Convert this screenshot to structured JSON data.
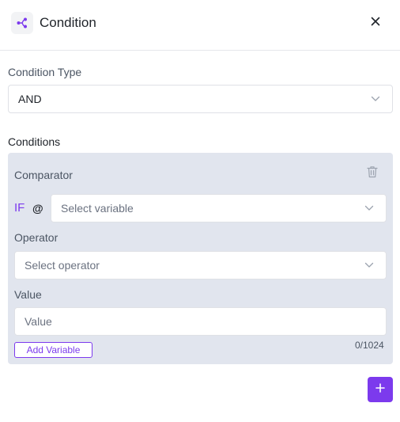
{
  "header": {
    "title": "Condition",
    "icon": "branch-icon",
    "close_icon": "close-icon"
  },
  "condition_type": {
    "label": "Condition Type",
    "value": "AND"
  },
  "conditions": {
    "label": "Conditions",
    "comparator": {
      "title": "Comparator",
      "delete_icon": "trash-icon",
      "if_label": "IF",
      "at_label": "@",
      "variable_placeholder": "Select variable",
      "operator_label": "Operator",
      "operator_placeholder": "Select operator",
      "value_label": "Value",
      "value_placeholder": "Value",
      "add_variable_label": "Add Variable",
      "char_counter": "0/1024"
    },
    "add_icon": "plus-icon"
  },
  "colors": {
    "accent": "#7c3aed",
    "card_background": "#e1e5ee"
  }
}
